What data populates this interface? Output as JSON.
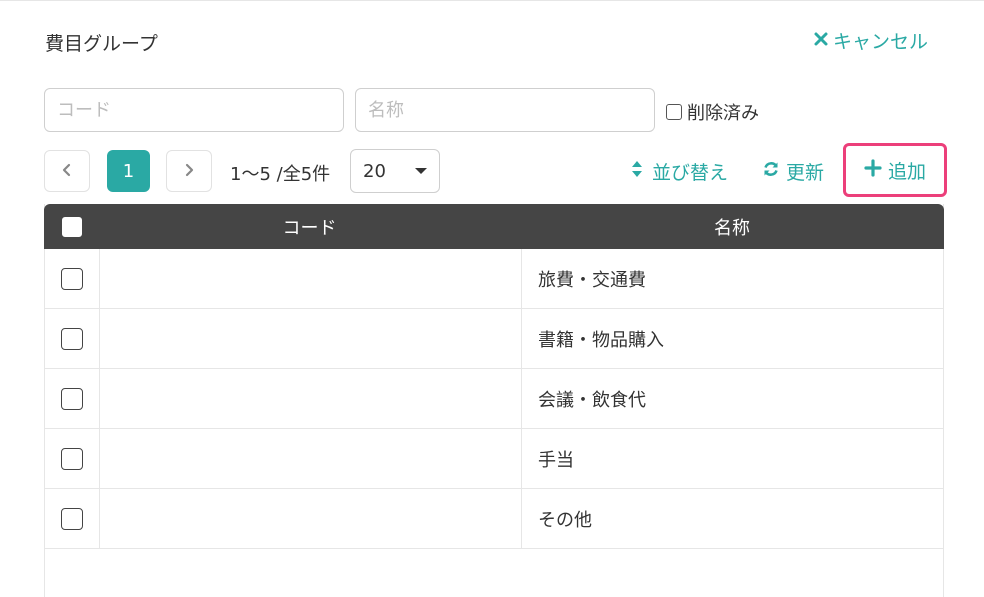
{
  "header": {
    "title": "費目グループ",
    "cancel_label": "キャンセル"
  },
  "filters": {
    "code_placeholder": "コード",
    "name_placeholder": "名称",
    "deleted_label": "削除済み"
  },
  "pager": {
    "current_page": "1",
    "range_text": "1〜5 /全5件",
    "per_page": "20"
  },
  "actions": {
    "sort_label": "並び替え",
    "refresh_label": "更新",
    "add_label": "追加"
  },
  "table": {
    "columns": [
      "コード",
      "名称"
    ],
    "rows": [
      {
        "code": "",
        "name": "旅費・交通費"
      },
      {
        "code": "",
        "name": "書籍・物品購入"
      },
      {
        "code": "",
        "name": "会議・飲食代"
      },
      {
        "code": "",
        "name": "手当"
      },
      {
        "code": "",
        "name": "その他"
      }
    ]
  },
  "colors": {
    "accent": "#2aa9a4",
    "header_bg": "#454545",
    "highlight_border": "#ec3f7a"
  }
}
